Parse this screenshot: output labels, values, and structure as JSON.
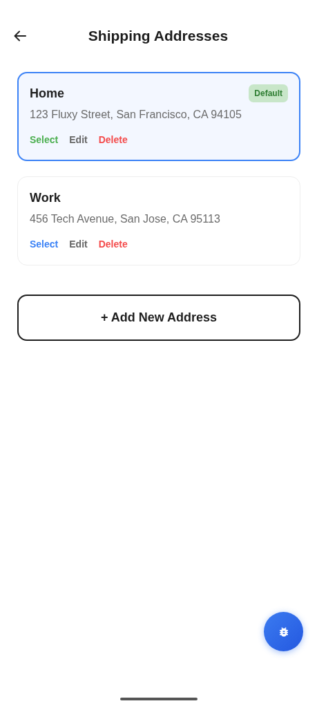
{
  "header": {
    "title": "Shipping Addresses"
  },
  "addresses": [
    {
      "name": "Home",
      "address": "123 Fluxy Street, San Francisco, CA 94105",
      "selected": true,
      "badge": "Default",
      "actions": {
        "select": "Select",
        "edit": "Edit",
        "delete": "Delete"
      }
    },
    {
      "name": "Work",
      "address": "456 Tech Avenue, San Jose, CA 95113",
      "selected": false,
      "actions": {
        "select": "Select",
        "edit": "Edit",
        "delete": "Delete"
      }
    }
  ],
  "add_button": "+ Add New Address"
}
